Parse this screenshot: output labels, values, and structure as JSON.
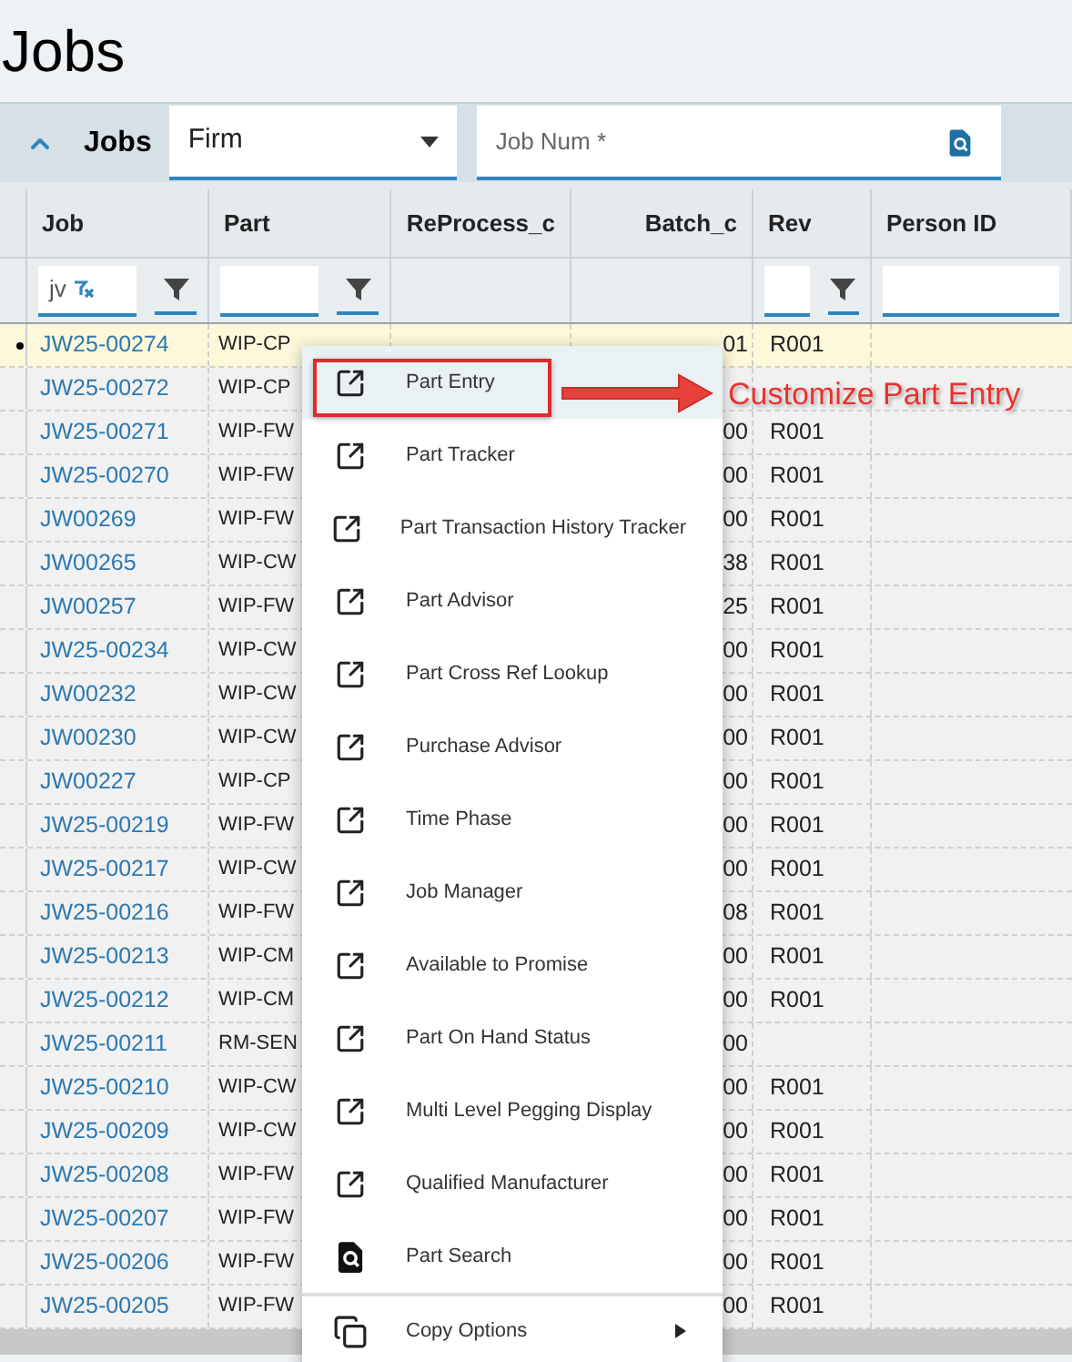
{
  "page_title": "Jobs",
  "panel": {
    "title": "Jobs",
    "expanded": true,
    "select": {
      "value": "Firm"
    },
    "search_field": {
      "placeholder": "Job Num *"
    }
  },
  "table": {
    "columns": [
      "Job",
      "Part",
      "ReProcess_c",
      "Batch_c",
      "Rev",
      "Person ID"
    ],
    "filters": [
      {
        "kind": "filter",
        "value": "jv",
        "clearable": true
      },
      {
        "kind": "filter",
        "clearable": false
      },
      {
        "kind": "blank"
      },
      {
        "kind": "blank"
      },
      {
        "kind": "filter",
        "clearable": false
      },
      {
        "kind": "input"
      }
    ],
    "rows": [
      {
        "job": "JW25-00274",
        "part": "WIP-CP",
        "batch": "01",
        "rev": "R001",
        "selected": true
      },
      {
        "job": "JW25-00272",
        "part": "WIP-CP",
        "selected": false
      },
      {
        "job": "JW25-00271",
        "part": "WIP-FW",
        "batch": "00",
        "rev": "R001",
        "selected": false
      },
      {
        "job": "JW25-00270",
        "part": "WIP-FW",
        "batch": "00",
        "rev": "R001",
        "selected": false
      },
      {
        "job": "JW00269",
        "part": "WIP-FW",
        "batch": "00",
        "rev": "R001",
        "selected": false
      },
      {
        "job": "JW00265",
        "part": "WIP-CW",
        "batch": "38",
        "rev": "R001",
        "selected": false
      },
      {
        "job": "JW00257",
        "part": "WIP-FW",
        "batch": "25",
        "rev": "R001",
        "selected": false
      },
      {
        "job": "JW25-00234",
        "part": "WIP-CW",
        "batch": "00",
        "rev": "R001",
        "selected": false
      },
      {
        "job": "JW00232",
        "part": "WIP-CW",
        "batch": "00",
        "rev": "R001",
        "selected": false
      },
      {
        "job": "JW00230",
        "part": "WIP-CW",
        "batch": "00",
        "rev": "R001",
        "selected": false
      },
      {
        "job": "JW00227",
        "part": "WIP-CP",
        "batch": "00",
        "rev": "R001",
        "selected": false
      },
      {
        "job": "JW25-00219",
        "part": "WIP-FW",
        "batch": "00",
        "rev": "R001",
        "selected": false
      },
      {
        "job": "JW25-00217",
        "part": "WIP-CW",
        "batch": "00",
        "rev": "R001",
        "selected": false
      },
      {
        "job": "JW25-00216",
        "part": "WIP-FW",
        "batch": "08",
        "rev": "R001",
        "selected": false
      },
      {
        "job": "JW25-00213",
        "part": "WIP-CM",
        "batch": "00",
        "rev": "R001",
        "selected": false
      },
      {
        "job": "JW25-00212",
        "part": "WIP-CM",
        "batch": "00",
        "rev": "R001",
        "selected": false
      },
      {
        "job": "JW25-00211",
        "part": "RM-SEN",
        "batch": "00",
        "selected": false
      },
      {
        "job": "JW25-00210",
        "part": "WIP-CW",
        "batch": "00",
        "rev": "R001",
        "selected": false
      },
      {
        "job": "JW25-00209",
        "part": "WIP-CW",
        "batch": "00",
        "rev": "R001",
        "selected": false
      },
      {
        "job": "JW25-00208",
        "part": "WIP-FW",
        "batch": "00",
        "rev": "R001",
        "selected": false
      },
      {
        "job": "JW25-00207",
        "part": "WIP-FW",
        "batch": "00",
        "rev": "R001",
        "selected": false
      },
      {
        "job": "JW25-00206",
        "part": "WIP-FW",
        "batch": "00",
        "rev": "R001",
        "selected": false
      },
      {
        "job": "JW25-00205",
        "part": "WIP-FW",
        "batch": "00",
        "rev": "R001",
        "selected": false
      }
    ]
  },
  "context_menu": {
    "items": [
      {
        "label": "Part Entry",
        "kind": "link",
        "highlighted": true
      },
      {
        "label": "Part Tracker",
        "kind": "link",
        "highlighted": false
      },
      {
        "label": "Part Transaction History Tracker",
        "kind": "link",
        "highlighted": false
      },
      {
        "label": "Part Advisor",
        "kind": "link",
        "highlighted": false
      },
      {
        "label": "Part Cross Ref Lookup",
        "kind": "link",
        "highlighted": false
      },
      {
        "label": "Purchase Advisor",
        "kind": "link",
        "highlighted": false
      },
      {
        "label": "Time Phase",
        "kind": "link",
        "highlighted": false
      },
      {
        "label": "Job Manager",
        "kind": "link",
        "highlighted": false
      },
      {
        "label": "Available to Promise",
        "kind": "link",
        "highlighted": false
      },
      {
        "label": "Part On Hand Status",
        "kind": "link",
        "highlighted": false
      },
      {
        "label": "Multi Level Pegging Display",
        "kind": "link",
        "highlighted": false
      },
      {
        "label": "Qualified Manufacturer",
        "kind": "link",
        "highlighted": false
      },
      {
        "label": "Part Search",
        "kind": "search",
        "highlighted": false
      },
      {
        "label": "Copy Options",
        "kind": "submenu",
        "highlighted": false
      }
    ]
  },
  "annotation": {
    "text": "Customize Part Entry"
  }
}
